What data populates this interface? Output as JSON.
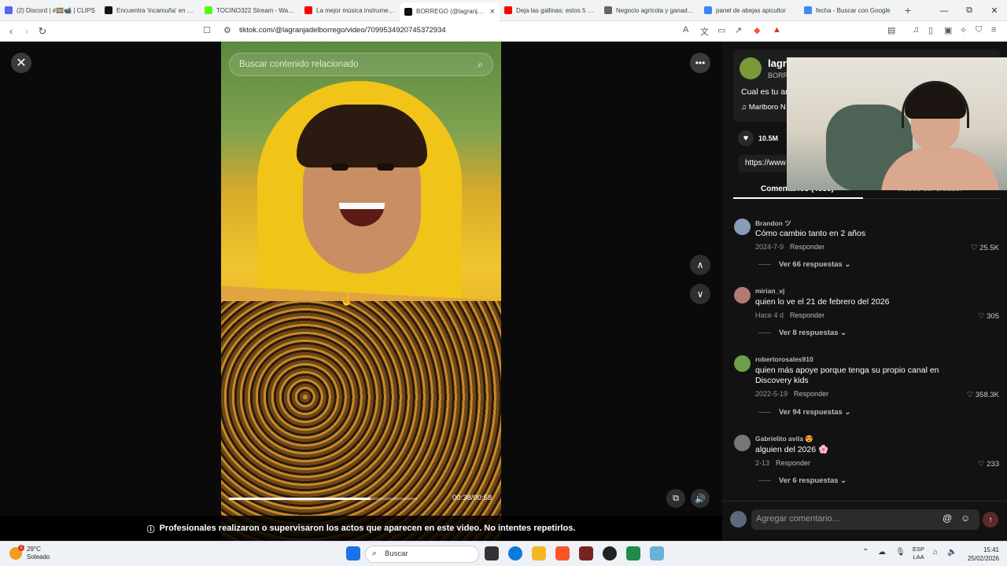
{
  "browser": {
    "tabs": [
      {
        "label": "(2) Discord | #🎞️📹 | CLIPS",
        "color": "#5865f2"
      },
      {
        "label": "Encuentra 'incamuña' en TikTok",
        "color": "#111111"
      },
      {
        "label": "TOCINO322 Stream - Watch",
        "color": "#53fc18"
      },
      {
        "label": "La mejor música instrumental",
        "color": "#ff0000"
      },
      {
        "label": "BORREGO (@lagranjadelborrego)",
        "color": "#111111",
        "active": true
      },
      {
        "label": "Deja las gallinas: estos 5 animales",
        "color": "#ff0000"
      },
      {
        "label": "Negocio agrícola y ganadero",
        "color": "#666666"
      },
      {
        "label": "panel de abejas apicultor",
        "color": "#4285f4"
      },
      {
        "label": "fecha - Buscar con Google",
        "color": "#4285f4"
      }
    ],
    "new_tab": "+",
    "url": "tiktok.com/@lagranjadelborrego/video/7099534920745372934",
    "win_min": "—",
    "win_max": "⧉",
    "win_close": "✕"
  },
  "video": {
    "search_placeholder": "Buscar contenido relacionado",
    "timecode": "00:38/00:58",
    "progress": 0.75,
    "disclaimer": "Profesionales realizaron o supervisaron los actos que aparecen en este video. No intentes repetirlos."
  },
  "panel": {
    "author_name": "lagr",
    "author_sub": "BORR",
    "description": "Cual es tu ar",
    "music": "Marlboro N",
    "likes": "10.5M",
    "link": "https://www",
    "tab_comments": "Comentarios (4655)",
    "tab_creator": "Videos del creador",
    "comments": [
      {
        "user": "Brandon ツ",
        "text": "Cómo cambio tanto en 2 años",
        "date": "2024-7-9",
        "reply": "Responder",
        "likes": "25.5K",
        "replies": "Ver 66 respuestas",
        "color": "#8a9bb8"
      },
      {
        "user": "mirian_vj",
        "text": "quien lo ve el 21 de febrero del 2026",
        "date": "Hace 4 d",
        "reply": "Responder",
        "likes": "305",
        "replies": "Ver 8 respuestas",
        "color": "#b07a70"
      },
      {
        "user": "robertorosales910",
        "text": "quien más apoye porque tenga su propio canal en Discovery kids",
        "date": "2022-5-19",
        "reply": "Responder",
        "likes": "358.3K",
        "replies": "Ver 94 respuestas",
        "color": "#6aa04a"
      },
      {
        "user": "Gabrielito avila 😍",
        "text": "alguien del 2026 🌸",
        "date": "2-13",
        "reply": "Responder",
        "likes": "233",
        "replies": "Ver 6 respuestas",
        "color": "#777777"
      }
    ],
    "comment_placeholder": "Agregar comentario..."
  },
  "taskbar": {
    "temp": "29°C",
    "weather": "Soleado",
    "weather_badge": "1",
    "search": "Buscar",
    "lang1": "ESP",
    "lang2": "LAA",
    "time": "15:41",
    "date": "25/02/2026"
  }
}
